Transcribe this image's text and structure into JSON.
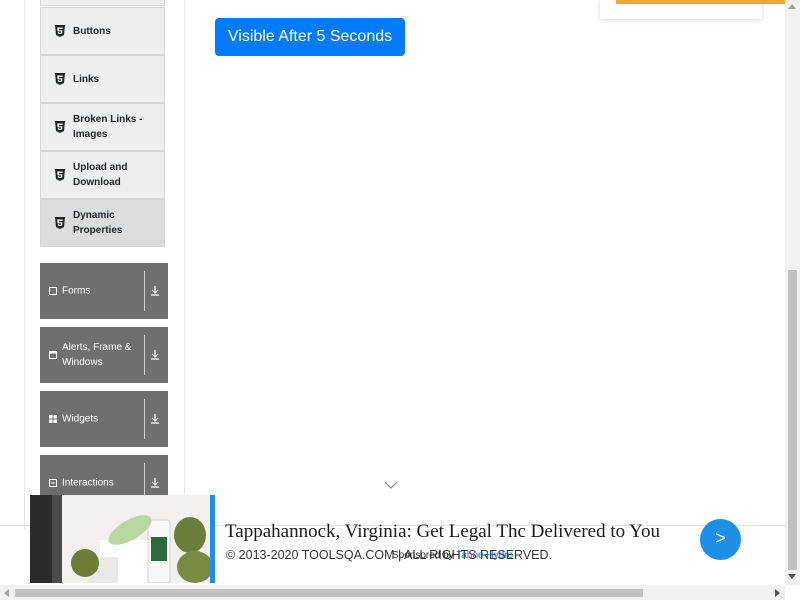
{
  "sidebar": {
    "sub_items": [
      {
        "label": "Buttons",
        "icon": "html5-icon"
      },
      {
        "label": "Links",
        "icon": "html5-icon"
      },
      {
        "label": "Broken Links - Images",
        "icon": "html5-icon"
      },
      {
        "label": "Upload and Download",
        "icon": "html5-icon"
      },
      {
        "label": "Dynamic Properties",
        "icon": "html5-icon",
        "active": true
      }
    ],
    "groups": [
      {
        "label": "Forms",
        "icon": "form-icon"
      },
      {
        "label": "Alerts, Frame & Windows",
        "icon": "window-icon"
      },
      {
        "label": "Widgets",
        "icon": "widgets-icon"
      },
      {
        "label": "Interactions",
        "icon": "interactions-icon"
      }
    ]
  },
  "main": {
    "visible_after_button": "Visible After 5 Seconds"
  },
  "footer": {
    "copyright": "© 2013-2020 TOOLSQA.COM | ALL RIGHTS RESERVED."
  },
  "ad": {
    "title": "Tappahannock, Virginia: Get Legal Thc Delivered to You",
    "sponsored_prefix": "Sponsored by",
    "sponsor": "Tahoe Hydro",
    "go_label": ">"
  },
  "colors": {
    "primary": "#007bff",
    "group_bg": "#6f6f6f",
    "ad_accent": "#1e8fe6"
  }
}
